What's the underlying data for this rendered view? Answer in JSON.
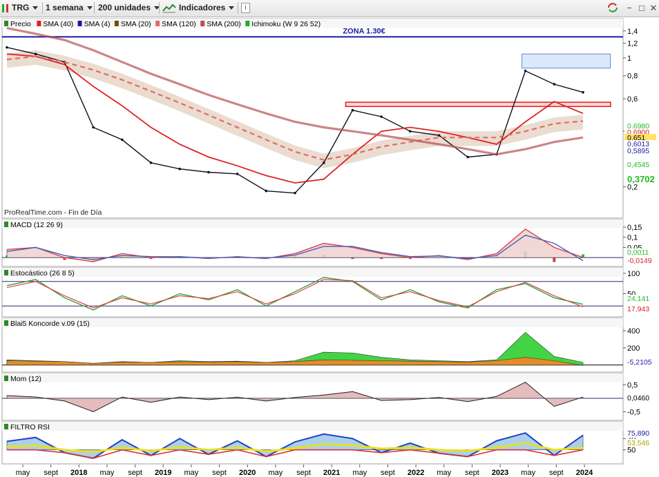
{
  "toolbar": {
    "symbol": "TRG",
    "timeframe": "1 semana",
    "units": "200 unidades",
    "indicators_label": "Indicadores",
    "info_icon": "info-icon",
    "sync_icon": "sync-icon",
    "window_controls": [
      "−",
      "□",
      "✕"
    ]
  },
  "colors": {
    "price": "#101020",
    "sma40": "#e02020",
    "sma4": "#1a1aa0",
    "sma20": "#6b4d10",
    "sma120": "#e26a6a",
    "sma200": "#b85050",
    "ichimoku": "#20b020",
    "macd": "#e04040",
    "macd_signal": "#4060c0",
    "stoch_k": "#30a040",
    "stoch_d": "#e04040",
    "koncorde_green": "#22cc22",
    "koncorde_orange": "#ff8020",
    "mom_fill": "#e0b0b0",
    "rsi_blue": "#2040c0",
    "rsi_red": "#e03030",
    "rsi_yellow": "#e8e020"
  },
  "price_panel": {
    "legend": [
      "Precio",
      "SMA (40)",
      "SMA (4)",
      "SMA (20)",
      "SMA (120)",
      "SMA (200)",
      "Ichimoku (W 9 26 52)"
    ],
    "zone_label": "ZONA 1.30€",
    "watermark": "ProRealTime.com - Fin de Día",
    "value_tags": [
      "0,6980",
      "0,6900",
      "0,651",
      "0,6013",
      "0,5895",
      "0,4545",
      "0,3702"
    ]
  },
  "macd_panel": {
    "legend": "MACD (12 26 9)",
    "value_tags": [
      "0,0011",
      "-0,0149"
    ]
  },
  "stoch_panel": {
    "legend": "Estocástico (26 8 5)",
    "value_tags": [
      "24,141",
      "17,943"
    ]
  },
  "koncorde_panel": {
    "legend": "Blai5 Koncorde v.09 (15)",
    "value_tags": [
      "-5,2105"
    ]
  },
  "mom_panel": {
    "legend": "Mom (12)",
    "value_tags": [
      "0,0460"
    ]
  },
  "rsi_panel": {
    "legend": "FILTRO RSI",
    "value_tags": [
      "75,890",
      "53,546"
    ]
  },
  "x_axis": {
    "labels": [
      "may",
      "sept",
      "2018",
      "may",
      "sept",
      "2019",
      "may",
      "sept",
      "2020",
      "may",
      "sept",
      "2021",
      "may",
      "sept",
      "2022",
      "may",
      "sept",
      "2023",
      "may",
      "sept",
      "2024"
    ],
    "bold": [
      "2018",
      "2019",
      "2020",
      "2021",
      "2022",
      "2023",
      "2024"
    ]
  },
  "chart_data": [
    {
      "type": "line",
      "title": "TRG",
      "y_scale": "log",
      "ylim": [
        0.14,
        1.55
      ],
      "yticks": [
        "1,4",
        "1,2",
        "1",
        "0,8",
        "0,6",
        "0,4",
        "0,2"
      ],
      "ytick_values": [
        1.4,
        1.2,
        1.0,
        0.8,
        0.6,
        0.4,
        0.2
      ],
      "horizontal_line": 1.3,
      "resistance_zone": [
        0.545,
        0.575
      ],
      "x": [
        "may 2017",
        "sept 2017",
        "2018",
        "may 2018",
        "sept 2018",
        "2019",
        "may 2019",
        "sept 2019",
        "2020",
        "may 2020",
        "sept 2020",
        "2021",
        "may 2021",
        "sept 2021",
        "2022",
        "may 2022",
        "sept 2022",
        "2023",
        "may 2023",
        "sept 2023",
        "nov 2023"
      ],
      "series": [
        {
          "name": "Precio",
          "values": [
            1.14,
            1.05,
            0.95,
            0.42,
            0.36,
            0.27,
            0.25,
            0.24,
            0.235,
            0.19,
            0.185,
            0.27,
            0.52,
            0.48,
            0.4,
            0.38,
            0.29,
            0.3,
            0.85,
            0.72,
            0.651
          ]
        },
        {
          "name": "SMA (40)",
          "values": [
            1.05,
            1.02,
            0.92,
            0.7,
            0.55,
            0.42,
            0.34,
            0.29,
            0.26,
            0.23,
            0.21,
            0.22,
            0.3,
            0.4,
            0.42,
            0.4,
            0.37,
            0.34,
            0.45,
            0.58,
            0.5
          ]
        },
        {
          "name": "SMA (120)",
          "values": [
            0.98,
            1.02,
            0.95,
            0.86,
            0.76,
            0.66,
            0.57,
            0.49,
            0.42,
            0.36,
            0.31,
            0.28,
            0.3,
            0.33,
            0.35,
            0.37,
            0.37,
            0.37,
            0.4,
            0.44,
            0.4545
          ]
        },
        {
          "name": "SMA (200)",
          "values": [
            1.45,
            1.35,
            1.25,
            1.1,
            0.95,
            0.82,
            0.72,
            0.63,
            0.56,
            0.5,
            0.45,
            0.42,
            0.4,
            0.38,
            0.36,
            0.34,
            0.32,
            0.3,
            0.32,
            0.35,
            0.3702
          ]
        }
      ]
    },
    {
      "type": "line",
      "title": "MACD (12 26 9)",
      "ylim": [
        -0.03,
        0.16
      ],
      "yticks": [
        "0,15",
        "0,1",
        "0,05"
      ],
      "ytick_values": [
        0.15,
        0.1,
        0.05
      ],
      "x": [
        "may 2017",
        "sept 2017",
        "2018",
        "may 2018",
        "sept 2018",
        "2019",
        "may 2019",
        "sept 2019",
        "2020",
        "may 2020",
        "sept 2020",
        "2021",
        "may 2021",
        "sept 2021",
        "2022",
        "may 2022",
        "sept 2022",
        "2023",
        "may 2023",
        "sept 2023",
        "nov 2023"
      ],
      "series": [
        {
          "name": "MACD",
          "values": [
            0.04,
            0.05,
            0.0,
            -0.02,
            0.02,
            0.0,
            0.005,
            -0.005,
            0.005,
            -0.005,
            0.02,
            0.07,
            0.05,
            0.02,
            0.0,
            0.01,
            -0.01,
            0.02,
            0.14,
            0.05,
            0.0011
          ]
        },
        {
          "name": "Señal",
          "values": [
            0.03,
            0.05,
            0.01,
            -0.01,
            0.01,
            0.005,
            0.004,
            -0.002,
            0.002,
            -0.003,
            0.012,
            0.055,
            0.055,
            0.025,
            0.005,
            0.008,
            -0.005,
            0.01,
            0.11,
            0.07,
            -0.0149
          ]
        }
      ]
    },
    {
      "type": "line",
      "title": "Estocástico (26 8 5)",
      "ylim": [
        0,
        100
      ],
      "yticks": [
        "100",
        "50"
      ],
      "ytick_values": [
        100,
        50
      ],
      "reference_lines": [
        80,
        20
      ],
      "x": [
        "may 2017",
        "sept 2017",
        "2018",
        "may 2018",
        "sept 2018",
        "2019",
        "may 2019",
        "sept 2019",
        "2020",
        "may 2020",
        "sept 2020",
        "2021",
        "may 2021",
        "sept 2021",
        "2022",
        "may 2022",
        "sept 2022",
        "2023",
        "may 2023",
        "sept 2023",
        "nov 2023"
      ],
      "series": [
        {
          "name": "%K",
          "values": [
            70,
            85,
            40,
            10,
            45,
            20,
            50,
            35,
            60,
            20,
            55,
            90,
            80,
            35,
            60,
            30,
            15,
            60,
            75,
            40,
            24.141
          ]
        },
        {
          "name": "%D",
          "values": [
            65,
            80,
            45,
            15,
            40,
            25,
            45,
            38,
            55,
            25,
            50,
            85,
            82,
            40,
            55,
            33,
            18,
            55,
            78,
            45,
            17.943
          ]
        }
      ]
    },
    {
      "type": "area",
      "title": "Blai5 Koncorde v.09 (15)",
      "ylim": [
        -50,
        480
      ],
      "yticks": [
        "400",
        "200"
      ],
      "ytick_values": [
        400,
        200
      ],
      "x": [
        "may 2017",
        "sept 2017",
        "2018",
        "may 2018",
        "sept 2018",
        "2019",
        "may 2019",
        "sept 2019",
        "2020",
        "may 2020",
        "sept 2020",
        "2021",
        "may 2021",
        "sept 2021",
        "2022",
        "may 2022",
        "sept 2022",
        "2023",
        "may 2023",
        "sept 2023",
        "nov 2023"
      ],
      "series": [
        {
          "name": "Manos fuertes",
          "values": [
            60,
            50,
            40,
            20,
            40,
            30,
            50,
            40,
            45,
            30,
            50,
            150,
            140,
            90,
            60,
            50,
            40,
            60,
            380,
            100,
            30
          ]
        },
        {
          "name": "Manos débiles",
          "values": [
            50,
            45,
            40,
            20,
            35,
            30,
            40,
            35,
            40,
            30,
            40,
            60,
            55,
            50,
            45,
            40,
            35,
            50,
            90,
            50,
            -5.2105
          ]
        }
      ]
    },
    {
      "type": "area",
      "title": "Mom (12)",
      "ylim": [
        -0.72,
        0.72
      ],
      "yticks": [
        "0,5",
        "-0,5"
      ],
      "ytick_values": [
        0.5,
        -0.5
      ],
      "x": [
        "may 2017",
        "sept 2017",
        "2018",
        "may 2018",
        "sept 2018",
        "2019",
        "may 2019",
        "sept 2019",
        "2020",
        "may 2020",
        "sept 2020",
        "2021",
        "may 2021",
        "sept 2021",
        "2022",
        "may 2022",
        "sept 2022",
        "2023",
        "may 2023",
        "sept 2023",
        "nov 2023"
      ],
      "series": [
        {
          "name": "Mom",
          "values": [
            0.1,
            0.05,
            -0.1,
            -0.5,
            0.05,
            -0.15,
            0.05,
            -0.05,
            0.04,
            -0.1,
            0.03,
            0.12,
            0.25,
            -0.08,
            -0.05,
            0.03,
            -0.12,
            0.07,
            0.6,
            -0.3,
            0.046
          ]
        }
      ]
    },
    {
      "type": "line",
      "title": "FILTRO RSI",
      "ylim": [
        30,
        90
      ],
      "yticks": [
        "70",
        "50"
      ],
      "ytick_values": [
        70,
        50
      ],
      "x": [
        "may 2017",
        "sept 2017",
        "2018",
        "may 2018",
        "sept 2018",
        "2019",
        "may 2019",
        "sept 2019",
        "2020",
        "may 2020",
        "sept 2020",
        "2021",
        "may 2021",
        "sept 2021",
        "2022",
        "may 2022",
        "sept 2022",
        "2023",
        "may 2023",
        "sept 2023",
        "nov 2023"
      ],
      "series": [
        {
          "name": "RSI",
          "values": [
            65,
            72,
            45,
            35,
            68,
            40,
            70,
            42,
            66,
            38,
            64,
            78,
            70,
            45,
            62,
            44,
            38,
            66,
            80,
            40,
            75.89
          ]
        },
        {
          "name": "RSI media",
          "values": [
            55,
            58,
            50,
            46,
            54,
            48,
            55,
            50,
            54,
            47,
            53,
            60,
            58,
            52,
            54,
            50,
            48,
            54,
            62,
            50,
            53.546
          ]
        }
      ]
    }
  ]
}
